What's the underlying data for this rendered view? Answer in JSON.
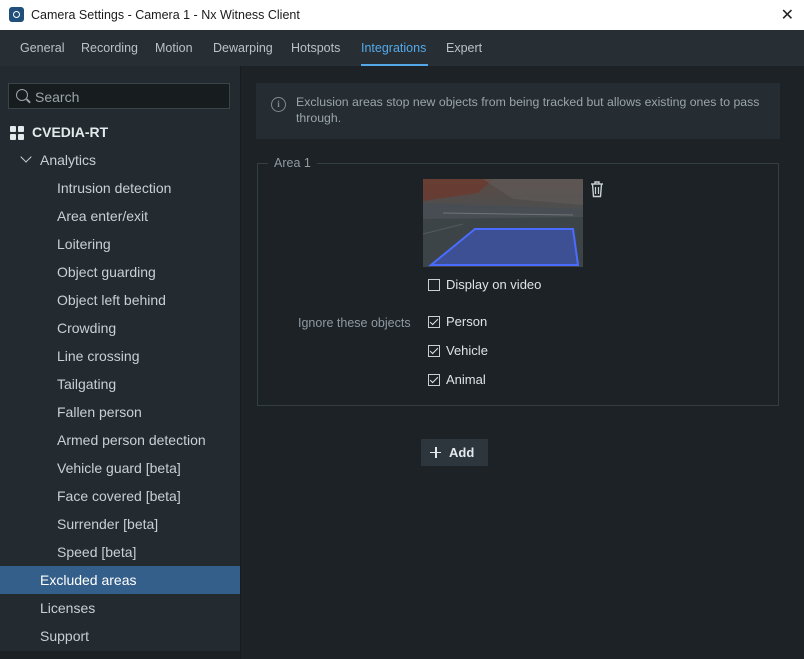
{
  "window": {
    "title": "Camera Settings - Camera 1 - Nx Witness Client",
    "close_icon": "close-icon"
  },
  "tabs": [
    {
      "label": "General"
    },
    {
      "label": "Recording"
    },
    {
      "label": "Motion"
    },
    {
      "label": "Dewarping"
    },
    {
      "label": "Hotspots"
    },
    {
      "label": "Integrations",
      "active": true
    },
    {
      "label": "Expert"
    }
  ],
  "sidebar": {
    "search_placeholder": "Search",
    "plugin": {
      "label": "CVEDIA-RT",
      "icon": "plugin-grid-icon"
    },
    "group": {
      "label": "Analytics",
      "icon": "chevron-down-icon"
    },
    "items": [
      {
        "label": "Intrusion detection"
      },
      {
        "label": "Area enter/exit"
      },
      {
        "label": "Loitering"
      },
      {
        "label": "Object guarding"
      },
      {
        "label": "Object left behind"
      },
      {
        "label": "Crowding"
      },
      {
        "label": "Line crossing"
      },
      {
        "label": "Tailgating"
      },
      {
        "label": "Fallen person"
      },
      {
        "label": "Armed person detection"
      },
      {
        "label": "Vehicle guard [beta]"
      },
      {
        "label": "Face covered [beta]"
      },
      {
        "label": "Surrender [beta]"
      },
      {
        "label": "Speed [beta]"
      }
    ],
    "top_items": [
      {
        "label": "Excluded areas",
        "selected": true
      },
      {
        "label": "Licenses"
      },
      {
        "label": "Support"
      }
    ]
  },
  "main": {
    "info": {
      "icon": "info-icon",
      "text": "Exclusion areas stop new objects from being tracked but allows existing ones to pass through."
    },
    "area": {
      "legend": "Area 1",
      "delete_icon": "trash-icon",
      "display_on_video": {
        "label": "Display on video",
        "checked": false
      },
      "ignore_label": "Ignore these objects",
      "objects": [
        {
          "label": "Person",
          "checked": true
        },
        {
          "label": "Vehicle",
          "checked": true
        },
        {
          "label": "Animal",
          "checked": true
        }
      ]
    },
    "add_button": {
      "label": "Add",
      "icon": "plus-icon"
    }
  },
  "colors": {
    "accent": "#55a8e8",
    "selected_item": "#335f8a",
    "background": "#1c2226",
    "sidebar": "#232b30",
    "exclusion_polygon": "#3f5ff0"
  }
}
